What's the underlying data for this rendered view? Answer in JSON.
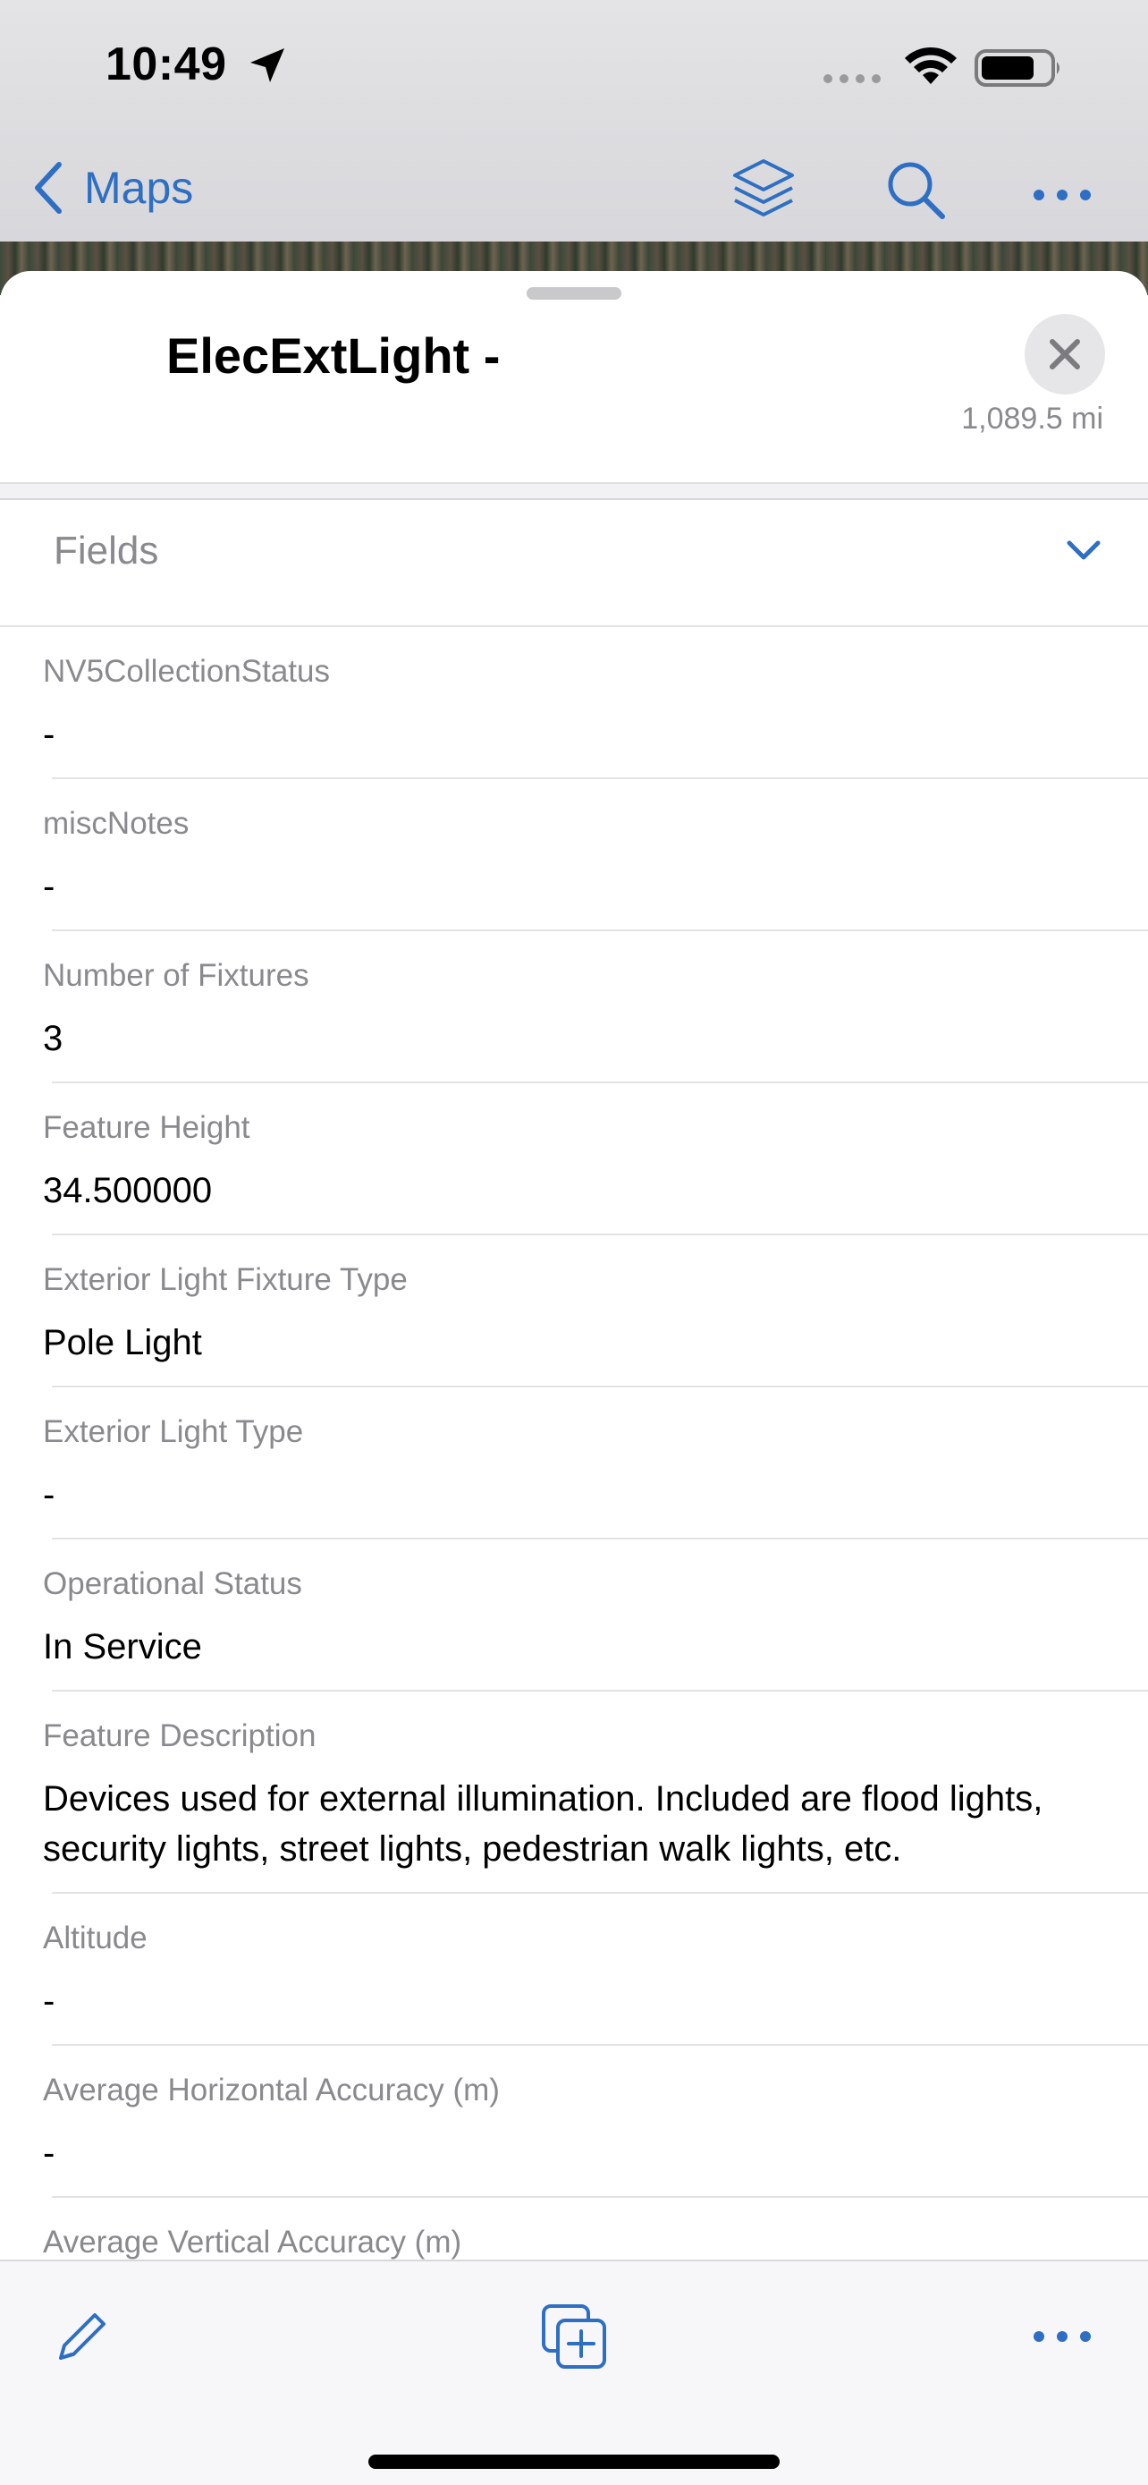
{
  "status_bar": {
    "time": "10:49",
    "icons": [
      "location-arrow-icon",
      "cellular-signal-icon",
      "wifi-icon",
      "battery-icon"
    ]
  },
  "nav_bar": {
    "back_label": "Maps",
    "icons": [
      "layers-icon",
      "search-icon",
      "more-icon"
    ],
    "accent_color": "#2e6fc3"
  },
  "sheet": {
    "title": "ElecExtLight -",
    "distance": "1,089.5 mi"
  },
  "section": {
    "label": "Fields"
  },
  "fields": [
    {
      "label": "NV5CollectionStatus",
      "value": "-"
    },
    {
      "label": "miscNotes",
      "value": "-"
    },
    {
      "label": "Number of Fixtures",
      "value": "3"
    },
    {
      "label": "Feature Height",
      "value": "34.500000"
    },
    {
      "label": "Exterior Light Fixture Type",
      "value": "Pole Light"
    },
    {
      "label": "Exterior Light Type",
      "value": "-"
    },
    {
      "label": "Operational Status",
      "value": "In Service"
    },
    {
      "label": "Feature Description",
      "value": "Devices used for external illumination.  Included are flood lights, security lights, street lights, pedestrian walk lights, etc."
    },
    {
      "label": "Altitude",
      "value": "-"
    },
    {
      "label": "Average Horizontal Accuracy (m)",
      "value": "-"
    },
    {
      "label": "Average Vertical Accuracy (m)",
      "value": ""
    }
  ],
  "toolbar": {
    "icons": [
      "edit-pencil-icon",
      "duplicate-add-icon",
      "more-icon"
    ]
  }
}
